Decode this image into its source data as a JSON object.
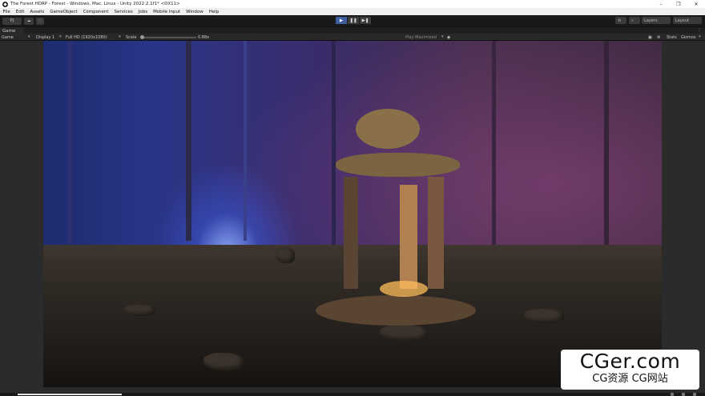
{
  "window": {
    "title": "The Forest HDRP - Forest - Windows, Mac, Linux - Unity 2022.2.1f1* <DX11>",
    "controls": [
      "–",
      "❐",
      "✕"
    ]
  },
  "menu": [
    "File",
    "Edit",
    "Assets",
    "GameObject",
    "Component",
    "Services",
    "Jobs",
    "Mobile Input",
    "Window",
    "Help"
  ],
  "toolbar": {
    "account_label": "PJ",
    "layers_label": "Layers",
    "layout_label": "Layout",
    "play_icons": [
      "▶",
      "❚❚",
      "▶❚"
    ]
  },
  "tab": {
    "label": "Game",
    "menu_icon": "⋮"
  },
  "gamebar": {
    "mode": "Game",
    "display": "Display 1",
    "resolution": "Full HD (1920x1080)",
    "scale_label": "Scale",
    "scale_value": "0.88x",
    "play_mode": "Play Maximized",
    "stats": "Stats",
    "gizmos": "Gizmos"
  },
  "watermark": {
    "line1": "CGer.com",
    "line2": "CG资源 CG网站"
  },
  "icons": {
    "app": "unity-logo-icon",
    "cloud": "cloud-icon",
    "history": "history-icon",
    "search": "search-icon",
    "audio": "audio-icon"
  },
  "colors": {
    "play_active": "#3d5fa0",
    "editor_bg": "#191919"
  }
}
